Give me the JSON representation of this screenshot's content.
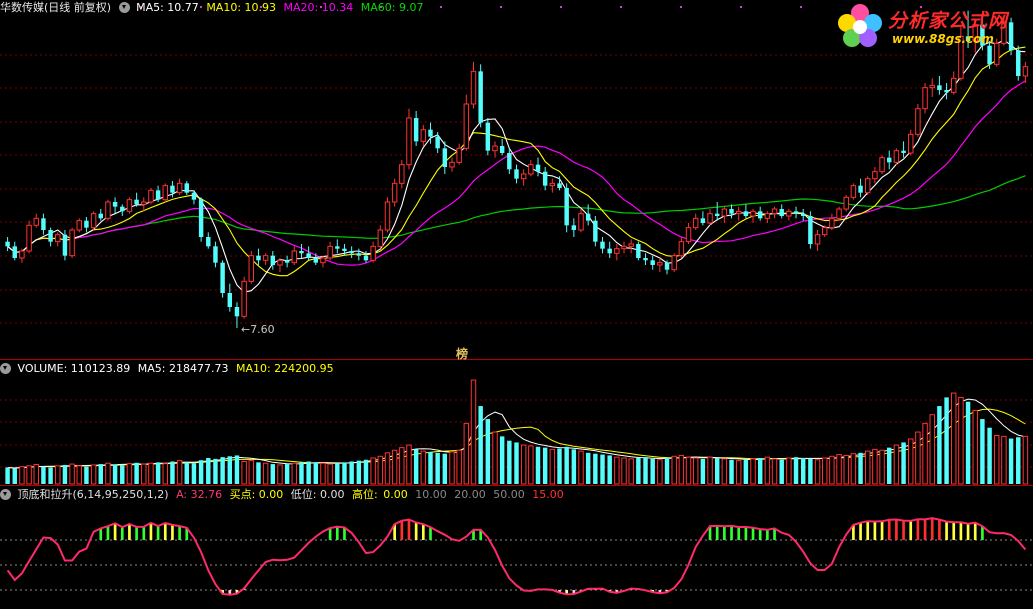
{
  "price_panel": {
    "title": "华数传媒(日线 前复权)",
    "ma5": "MA5: 10.77",
    "ma10": "MA10: 10.93",
    "ma20": "MA20: 10.34",
    "ma60": "MA60: 9.07",
    "low_marker": "7.60",
    "bang_mark": "榜"
  },
  "volume_panel": {
    "volume": "VOLUME: 110123.89",
    "ma5": "MA5: 218477.73",
    "ma10": "MA10: 224200.95"
  },
  "indicator_panel": {
    "name": "顶底和拉升(6,14,95,250,1,2)",
    "a": "A: 32.76",
    "buy": "买点: 0.00",
    "low": "低位: 0.00",
    "high_label": "高位:",
    "levels": [
      "0.00",
      "10.00",
      "20.00",
      "50.00",
      "15.00"
    ]
  },
  "logo": {
    "name": "分析家公式网",
    "url": "www.88gs.com"
  },
  "colors": {
    "up": "#ff3232",
    "down": "#54fcfc",
    "ma5": "#ffffff",
    "ma10": "#ffff00",
    "ma20": "#ff00ff",
    "ma60": "#00cc00",
    "indicator": "#ff2a6a",
    "divider": "#b00000",
    "grid": "#7a0000"
  },
  "chart_data": {
    "type": "candlestick",
    "price_axis": [
      7.0,
      14.2
    ],
    "candles": [
      [
        9.45,
        9.55,
        9.25,
        9.35
      ],
      [
        9.35,
        9.45,
        9.05,
        9.1
      ],
      [
        9.1,
        9.3,
        9.0,
        9.25
      ],
      [
        9.25,
        9.9,
        9.2,
        9.8
      ],
      [
        9.8,
        10.05,
        9.75,
        9.95
      ],
      [
        9.95,
        10.05,
        9.6,
        9.7
      ],
      [
        9.7,
        9.75,
        9.35,
        9.45
      ],
      [
        9.45,
        9.65,
        9.35,
        9.6
      ],
      [
        9.6,
        9.7,
        9.05,
        9.15
      ],
      [
        9.15,
        9.75,
        9.1,
        9.7
      ],
      [
        9.7,
        9.95,
        9.65,
        9.9
      ],
      [
        9.9,
        9.98,
        9.65,
        9.75
      ],
      [
        9.75,
        10.1,
        9.7,
        10.05
      ],
      [
        10.05,
        10.15,
        9.9,
        9.95
      ],
      [
        9.95,
        10.35,
        9.9,
        10.3
      ],
      [
        10.3,
        10.4,
        10.05,
        10.2
      ],
      [
        10.2,
        10.25,
        10.0,
        10.1
      ],
      [
        10.1,
        10.4,
        10.05,
        10.35
      ],
      [
        10.35,
        10.5,
        10.2,
        10.25
      ],
      [
        10.25,
        10.4,
        10.1,
        10.3
      ],
      [
        10.3,
        10.6,
        10.25,
        10.55
      ],
      [
        10.55,
        10.65,
        10.3,
        10.35
      ],
      [
        10.35,
        10.7,
        10.3,
        10.65
      ],
      [
        10.65,
        10.75,
        10.4,
        10.5
      ],
      [
        10.5,
        10.8,
        10.45,
        10.7
      ],
      [
        10.7,
        10.75,
        10.45,
        10.5
      ],
      [
        10.5,
        10.55,
        10.25,
        10.35
      ],
      [
        10.35,
        10.4,
        9.45,
        9.55
      ],
      [
        9.55,
        9.65,
        9.3,
        9.35
      ],
      [
        9.35,
        9.45,
        8.9,
        9.0
      ],
      [
        9.0,
        9.05,
        8.25,
        8.35
      ],
      [
        8.35,
        8.55,
        7.95,
        8.05
      ],
      [
        8.05,
        8.15,
        7.6,
        7.85
      ],
      [
        7.85,
        8.7,
        7.8,
        8.6
      ],
      [
        8.6,
        9.25,
        8.55,
        9.15
      ],
      [
        9.15,
        9.3,
        8.95,
        9.05
      ],
      [
        9.05,
        9.2,
        8.95,
        9.15
      ],
      [
        9.15,
        9.25,
        8.85,
        8.95
      ],
      [
        8.95,
        9.1,
        8.8,
        9.05
      ],
      [
        9.05,
        9.15,
        8.9,
        9.0
      ],
      [
        9.0,
        9.35,
        8.95,
        9.25
      ],
      [
        9.25,
        9.4,
        9.1,
        9.2
      ],
      [
        9.2,
        9.35,
        9.05,
        9.1
      ],
      [
        9.1,
        9.2,
        8.95,
        9.0
      ],
      [
        9.0,
        9.15,
        8.9,
        9.1
      ],
      [
        9.1,
        9.45,
        9.05,
        9.35
      ],
      [
        9.35,
        9.5,
        9.2,
        9.3
      ],
      [
        9.3,
        9.4,
        9.15,
        9.25
      ],
      [
        9.25,
        9.35,
        9.1,
        9.2
      ],
      [
        9.2,
        9.3,
        9.05,
        9.15
      ],
      [
        9.15,
        9.25,
        9.0,
        9.05
      ],
      [
        9.05,
        9.45,
        9.0,
        9.35
      ],
      [
        9.35,
        9.8,
        9.3,
        9.7
      ],
      [
        9.7,
        10.4,
        9.65,
        10.3
      ],
      [
        10.3,
        10.8,
        10.2,
        10.7
      ],
      [
        10.7,
        11.2,
        10.6,
        11.1
      ],
      [
        11.1,
        12.3,
        11.0,
        12.1
      ],
      [
        12.1,
        12.25,
        11.5,
        11.6
      ],
      [
        11.6,
        11.95,
        11.5,
        11.85
      ],
      [
        11.85,
        12.0,
        11.55,
        11.7
      ],
      [
        11.7,
        11.8,
        11.35,
        11.45
      ],
      [
        11.45,
        11.6,
        10.9,
        11.05
      ],
      [
        11.05,
        11.25,
        10.95,
        11.15
      ],
      [
        11.15,
        11.55,
        11.1,
        11.45
      ],
      [
        11.45,
        12.6,
        11.4,
        12.4
      ],
      [
        12.4,
        13.3,
        12.3,
        13.1
      ],
      [
        13.1,
        13.25,
        11.9,
        12.0
      ],
      [
        12.0,
        12.1,
        11.3,
        11.4
      ],
      [
        11.4,
        11.6,
        11.25,
        11.5
      ],
      [
        11.5,
        11.65,
        11.3,
        11.35
      ],
      [
        11.35,
        11.45,
        10.9,
        11.0
      ],
      [
        11.0,
        11.1,
        10.7,
        10.8
      ],
      [
        10.8,
        11.0,
        10.65,
        10.9
      ],
      [
        10.9,
        11.2,
        10.85,
        11.1
      ],
      [
        11.1,
        11.25,
        10.85,
        10.95
      ],
      [
        10.95,
        11.05,
        10.55,
        10.65
      ],
      [
        10.65,
        10.8,
        10.5,
        10.7
      ],
      [
        10.7,
        10.85,
        10.55,
        10.6
      ],
      [
        10.6,
        10.7,
        9.65,
        9.8
      ],
      [
        9.8,
        9.95,
        9.55,
        9.7
      ],
      [
        9.7,
        10.15,
        9.65,
        10.05
      ],
      [
        10.05,
        10.25,
        9.8,
        9.9
      ],
      [
        9.9,
        10.0,
        9.35,
        9.45
      ],
      [
        9.45,
        9.55,
        9.2,
        9.3
      ],
      [
        9.3,
        9.45,
        9.1,
        9.2
      ],
      [
        9.2,
        9.4,
        9.05,
        9.3
      ],
      [
        9.3,
        9.45,
        9.2,
        9.35
      ],
      [
        9.35,
        9.5,
        9.2,
        9.4
      ],
      [
        9.4,
        9.45,
        9.05,
        9.1
      ],
      [
        9.1,
        9.2,
        8.95,
        9.05
      ],
      [
        9.05,
        9.15,
        8.85,
        8.95
      ],
      [
        8.95,
        9.1,
        8.8,
        9.0
      ],
      [
        9.0,
        9.05,
        8.75,
        8.85
      ],
      [
        8.85,
        9.2,
        8.8,
        9.15
      ],
      [
        9.15,
        9.55,
        9.1,
        9.45
      ],
      [
        9.45,
        9.85,
        9.4,
        9.75
      ],
      [
        9.75,
        10.05,
        9.7,
        9.95
      ],
      [
        9.95,
        10.1,
        9.8,
        9.85
      ],
      [
        9.85,
        10.15,
        9.8,
        10.05
      ],
      [
        10.05,
        10.3,
        9.9,
        10.0
      ],
      [
        10.0,
        10.2,
        9.85,
        10.15
      ],
      [
        10.15,
        10.25,
        9.95,
        10.05
      ],
      [
        10.05,
        10.2,
        9.9,
        10.1
      ],
      [
        10.1,
        10.25,
        9.95,
        10.0
      ],
      [
        10.0,
        10.15,
        9.85,
        10.1
      ],
      [
        10.1,
        10.2,
        9.9,
        9.95
      ],
      [
        9.95,
        10.1,
        9.85,
        10.05
      ],
      [
        10.05,
        10.2,
        9.95,
        10.15
      ],
      [
        10.15,
        10.25,
        9.95,
        10.0
      ],
      [
        10.0,
        10.15,
        9.9,
        10.1
      ],
      [
        10.1,
        10.2,
        9.95,
        10.05
      ],
      [
        10.05,
        10.15,
        9.9,
        10.0
      ],
      [
        10.0,
        10.1,
        9.3,
        9.4
      ],
      [
        9.4,
        9.7,
        9.25,
        9.6
      ],
      [
        9.6,
        9.8,
        9.55,
        9.75
      ],
      [
        9.75,
        10.05,
        9.7,
        9.95
      ],
      [
        9.95,
        10.2,
        9.9,
        10.15
      ],
      [
        10.15,
        10.45,
        10.1,
        10.4
      ],
      [
        10.4,
        10.7,
        10.35,
        10.65
      ],
      [
        10.65,
        10.8,
        10.4,
        10.5
      ],
      [
        10.5,
        10.85,
        10.45,
        10.8
      ],
      [
        10.8,
        11.05,
        10.7,
        10.95
      ],
      [
        10.95,
        11.3,
        10.9,
        11.25
      ],
      [
        11.25,
        11.4,
        11.0,
        11.15
      ],
      [
        11.15,
        11.45,
        11.1,
        11.4
      ],
      [
        11.4,
        11.6,
        11.25,
        11.35
      ],
      [
        11.35,
        11.85,
        11.3,
        11.75
      ],
      [
        11.75,
        12.4,
        11.7,
        12.3
      ],
      [
        12.3,
        12.85,
        12.2,
        12.75
      ],
      [
        12.75,
        12.95,
        12.55,
        12.8
      ],
      [
        12.8,
        13.0,
        12.6,
        12.7
      ],
      [
        12.7,
        12.85,
        12.5,
        12.65
      ],
      [
        12.65,
        13.1,
        12.6,
        12.95
      ],
      [
        12.95,
        14.05,
        12.9,
        13.85
      ],
      [
        13.85,
        14.4,
        13.6,
        13.75
      ],
      [
        13.75,
        14.2,
        13.5,
        14.1
      ],
      [
        14.1,
        14.2,
        13.55,
        13.65
      ],
      [
        13.65,
        13.75,
        13.15,
        13.25
      ],
      [
        13.25,
        13.8,
        13.2,
        13.7
      ],
      [
        13.7,
        14.25,
        13.65,
        14.15
      ],
      [
        14.15,
        14.25,
        13.45,
        13.55
      ],
      [
        13.55,
        13.65,
        12.9,
        13.0
      ],
      [
        13.0,
        13.3,
        12.85,
        13.2
      ]
    ],
    "ma5": [
      10.77
    ],
    "ma10": [
      10.93
    ],
    "ma20": [
      10.34
    ],
    "ma60": [
      9.07
    ],
    "low_annotation": 7.6,
    "volume": [
      38,
      36,
      40,
      42,
      45,
      40,
      38,
      42,
      44,
      46,
      42,
      40,
      44,
      46,
      48,
      45,
      43,
      47,
      49,
      46,
      48,
      50,
      47,
      52,
      54,
      50,
      48,
      55,
      60,
      58,
      62,
      64,
      66,
      52,
      54,
      50,
      48,
      46,
      44,
      46,
      48,
      50,
      52,
      50,
      48,
      46,
      48,
      50,
      52,
      54,
      56,
      60,
      64,
      72,
      78,
      84,
      90,
      80,
      76,
      74,
      72,
      70,
      74,
      78,
      140,
      240,
      180,
      150,
      120,
      110,
      100,
      96,
      90,
      88,
      86,
      84,
      80,
      82,
      86,
      80,
      76,
      72,
      70,
      68,
      66,
      62,
      60,
      58,
      60,
      62,
      58,
      56,
      60,
      64,
      66,
      62,
      60,
      58,
      62,
      60,
      58,
      56,
      54,
      56,
      58,
      60,
      62,
      58,
      56,
      60,
      62,
      60,
      58,
      56,
      60,
      64,
      68,
      66,
      70,
      72,
      76,
      80,
      78,
      84,
      90,
      96,
      104,
      120,
      140,
      160,
      180,
      200,
      210,
      200,
      190,
      170,
      150,
      130,
      112,
      110,
      105,
      108,
      110
    ],
    "volume_ma5": 218477.73,
    "volume_ma10": 224200.95,
    "indicator_levels": [
      0,
      10,
      20,
      50,
      15
    ],
    "indicator_a": 32.76
  }
}
